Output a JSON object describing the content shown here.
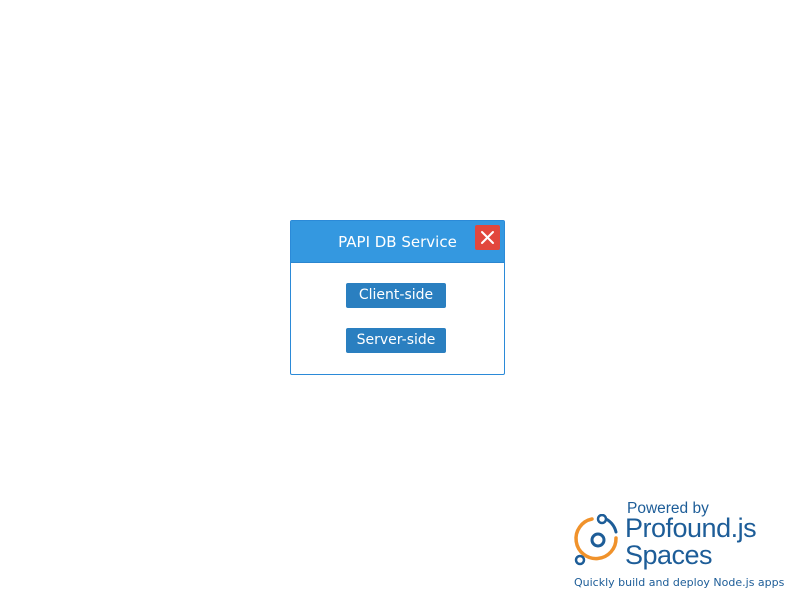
{
  "dialog": {
    "title": "PAPI DB Service",
    "close_icon": "close-icon",
    "buttons": {
      "client_side": "Client-side",
      "server_side": "Server-side"
    }
  },
  "branding": {
    "powered_by": "Powered by",
    "name_line1": "Profound.js",
    "name_line2": "Spaces",
    "tagline": "Quickly build and deploy Node.js apps",
    "logo_icon": "profoundjs-logo-icon"
  },
  "colors": {
    "header_bg": "#3498e0",
    "button_bg": "#2a7fc0",
    "close_bg": "#e2473d",
    "brand_blue": "#1d5d98",
    "brand_orange": "#f0922b"
  }
}
